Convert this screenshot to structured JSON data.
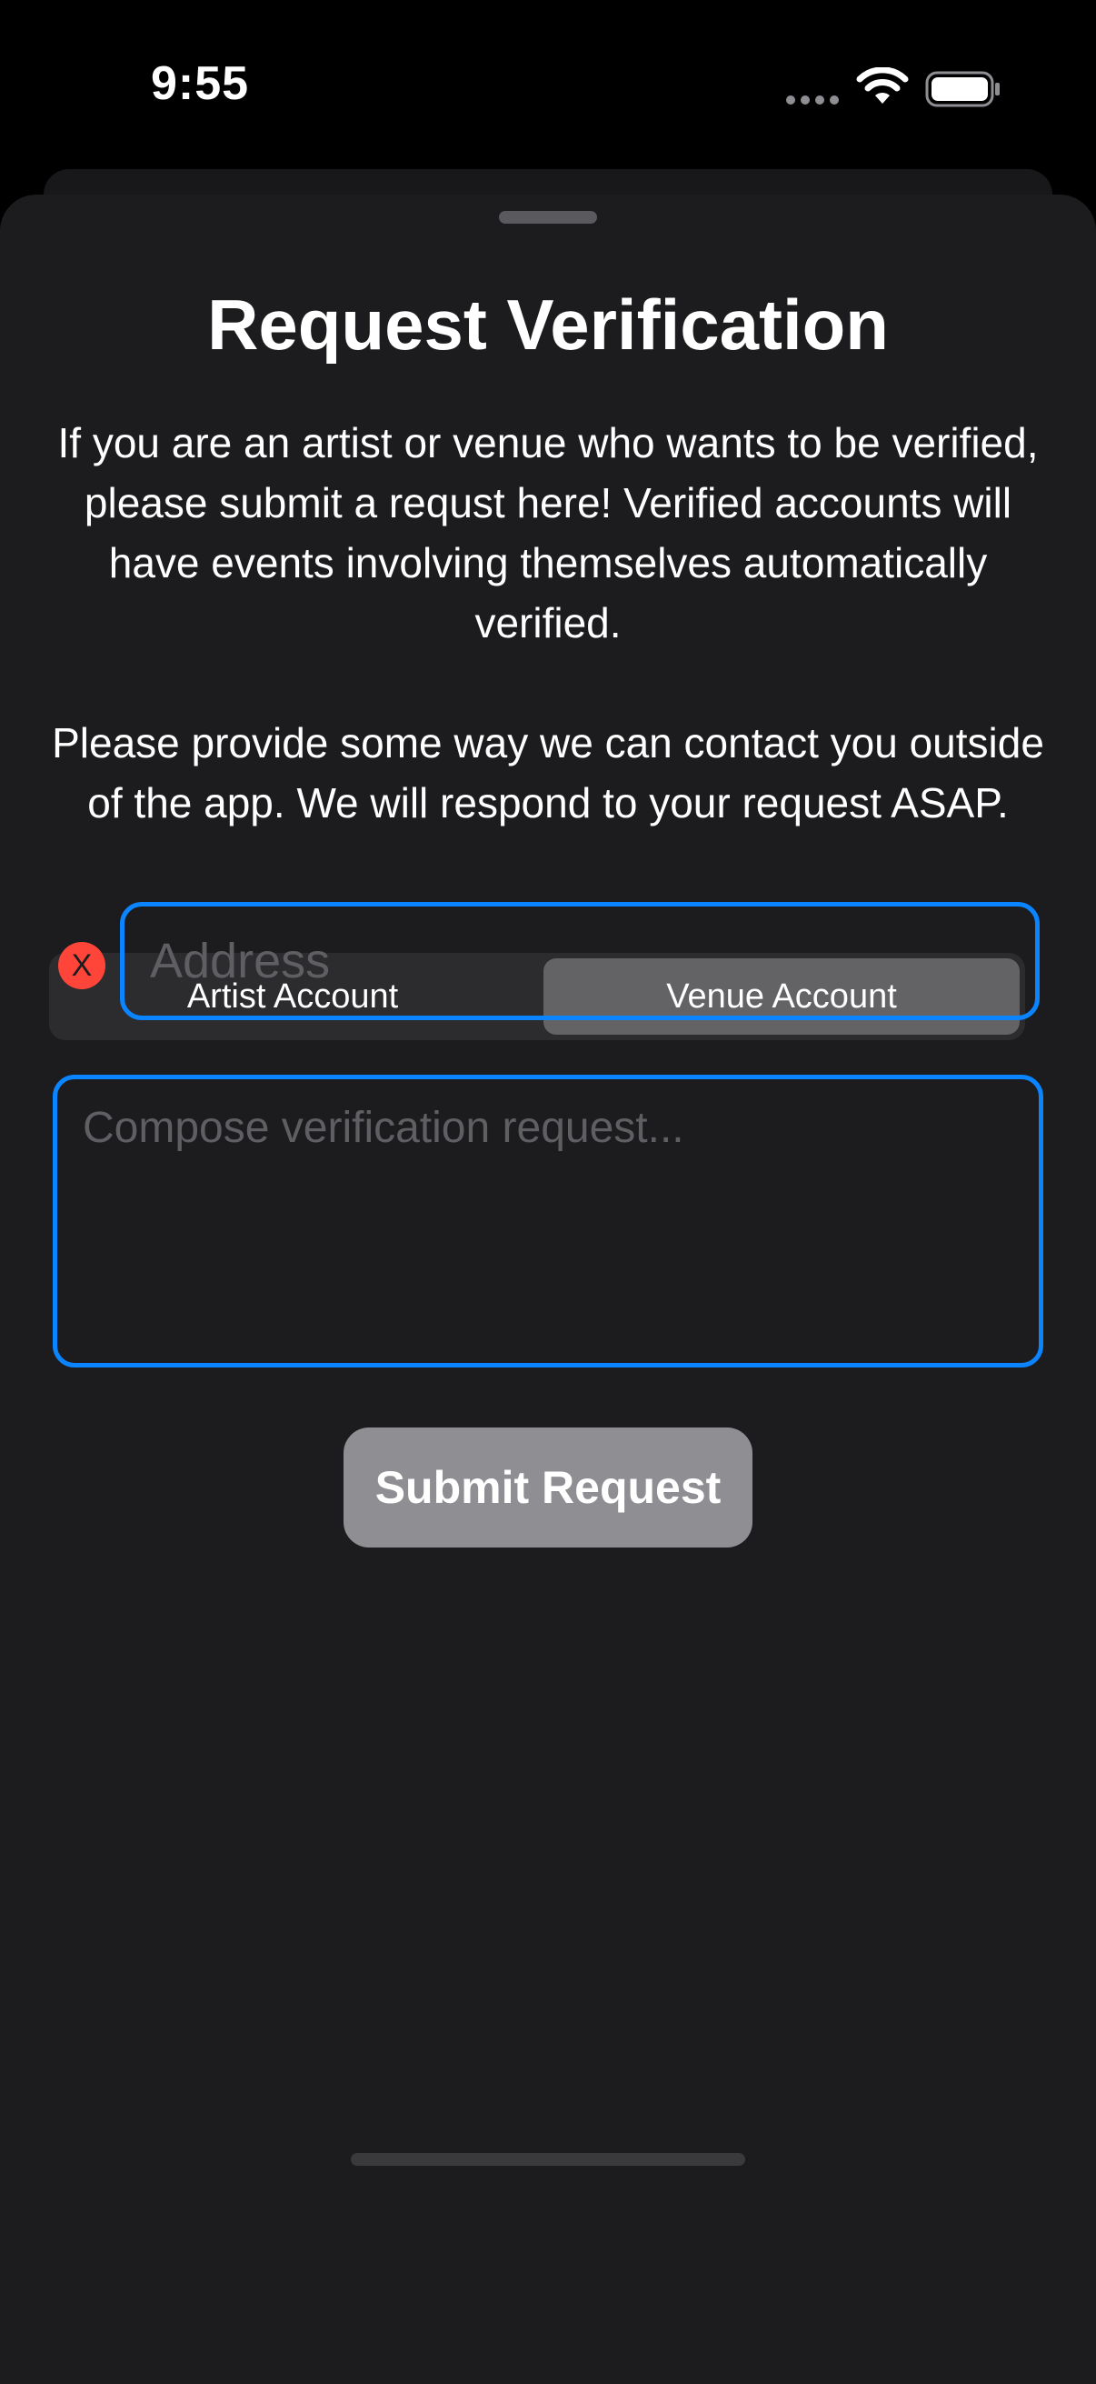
{
  "status_bar": {
    "time": "9:55"
  },
  "sheet": {
    "title": "Request Verification",
    "description_paragraphs": [
      "If you are an artist or venue who wants to be verified, please submit a requst here! Verified accounts will have events involving themselves automatically verified.",
      "Please provide some way we can contact you outside of the app. We will respond to your request ASAP."
    ]
  },
  "account_type": {
    "options": [
      "Artist Account",
      "Venue Account"
    ],
    "selected": "Venue Account"
  },
  "address": {
    "value": "",
    "placeholder": "Address",
    "error_icon_glyph": "X"
  },
  "request": {
    "value": "",
    "placeholder": "Compose verification request..."
  },
  "submit": {
    "label": "Submit Request"
  },
  "colors": {
    "accent": "#0a84ff",
    "error": "#ff453a",
    "sheet_background": "#1c1c1e",
    "disabled_button": "#8e8e93"
  },
  "icons": {
    "signal": "cellular-signal-icon",
    "wifi": "wifi-icon",
    "battery": "battery-icon",
    "error": "error-x-icon"
  }
}
